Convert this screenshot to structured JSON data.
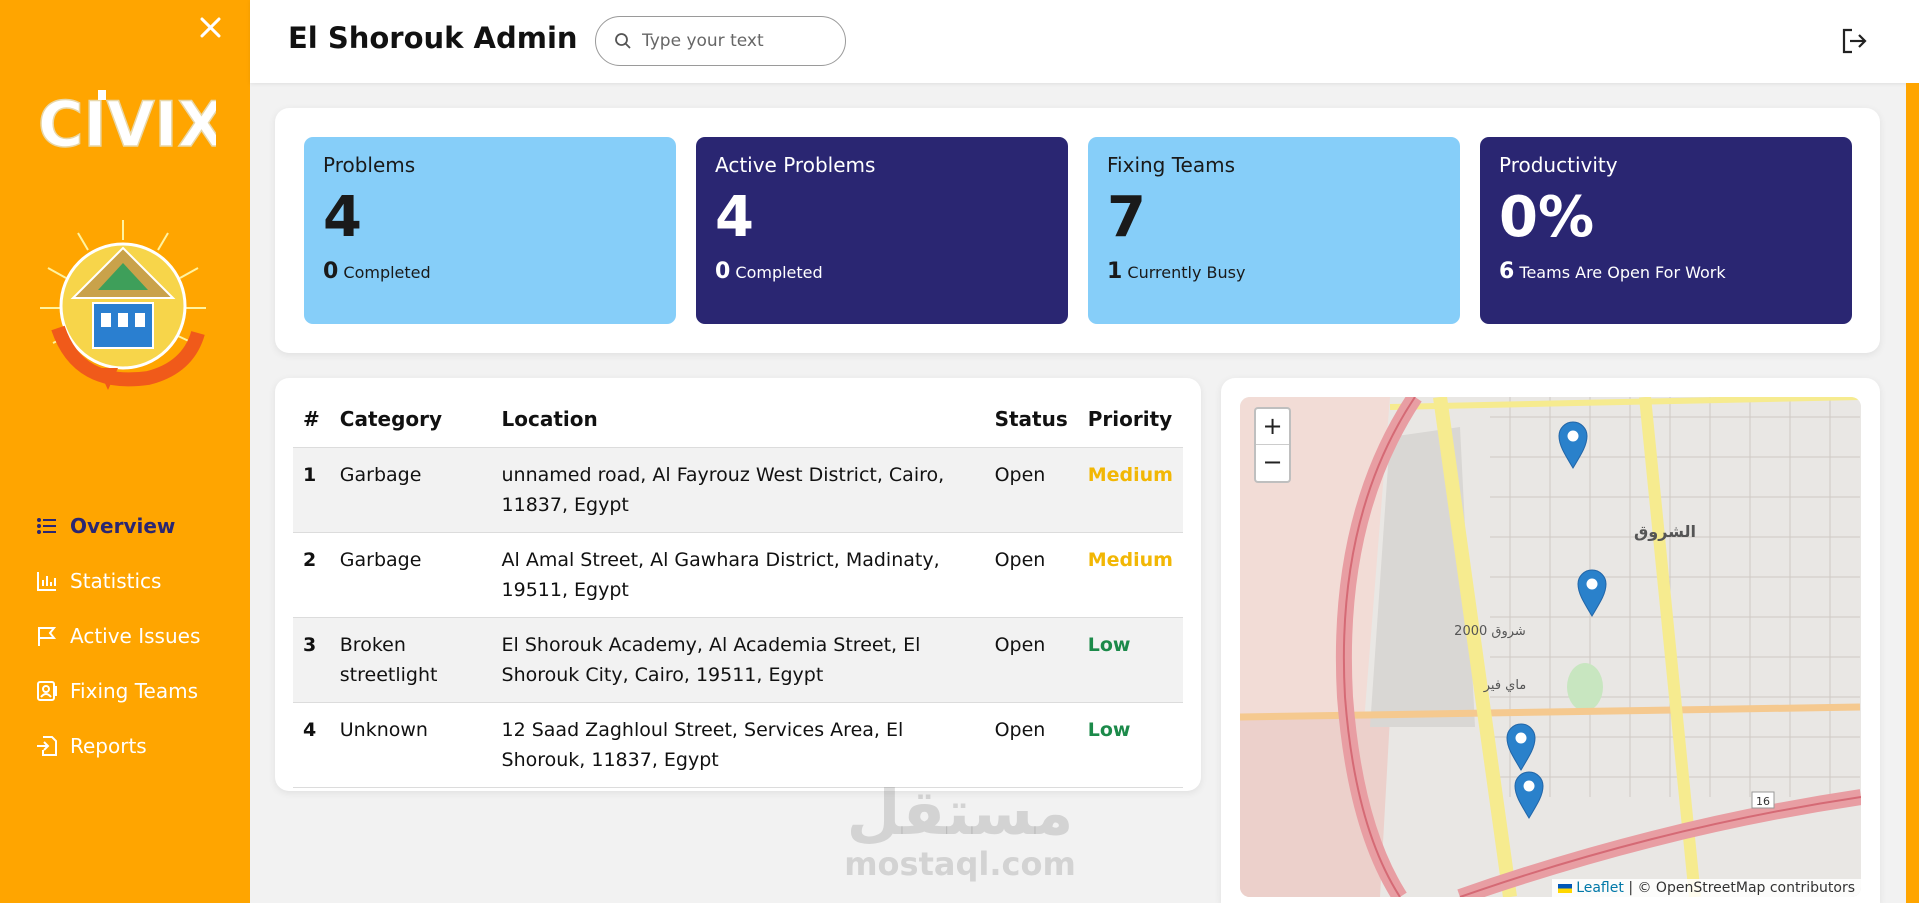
{
  "app": {
    "brand": "CIVIX",
    "brand_color": "#ffa500",
    "accent_dark": "#2a2672",
    "accent_light": "#86cef9"
  },
  "header": {
    "title": "El Shorouk Admin",
    "search_placeholder": "Type your text"
  },
  "sidebar": {
    "items": [
      {
        "label": "Overview",
        "icon": "list-icon",
        "active": true
      },
      {
        "label": "Statistics",
        "icon": "bar-chart-icon",
        "active": false
      },
      {
        "label": "Active Issues",
        "icon": "flag-icon",
        "active": false
      },
      {
        "label": "Fixing Teams",
        "icon": "team-icon",
        "active": false
      },
      {
        "label": "Reports",
        "icon": "report-icon",
        "active": false
      }
    ]
  },
  "stats": [
    {
      "title": "Problems",
      "value": "4",
      "sub_value": "0",
      "sub_label": "Completed",
      "style": "light"
    },
    {
      "title": "Active Problems",
      "value": "4",
      "sub_value": "0",
      "sub_label": "Completed",
      "style": "dark"
    },
    {
      "title": "Fixing Teams",
      "value": "7",
      "sub_value": "1",
      "sub_label": "Currently Busy",
      "style": "light"
    },
    {
      "title": "Productivity",
      "value": "0%",
      "sub_value": "6",
      "sub_label": "Teams Are Open For Work",
      "style": "dark"
    }
  ],
  "table": {
    "headers": [
      "#",
      "Category",
      "Location",
      "Status",
      "Priority"
    ],
    "rows": [
      {
        "num": "1",
        "category": "Garbage",
        "location": "unnamed road, Al Fayrouz West District, Cairo, 11837, Egypt",
        "status": "Open",
        "priority": "Medium"
      },
      {
        "num": "2",
        "category": "Garbage",
        "location": "Al Amal Street, Al Gawhara District, Madinaty, 19511, Egypt",
        "status": "Open",
        "priority": "Medium"
      },
      {
        "num": "3",
        "category": "Broken streetlight",
        "location": "El Shorouk Academy, Al Academia Street, El Shorouk City, Cairo, 19511, Egypt",
        "status": "Open",
        "priority": "Low"
      },
      {
        "num": "4",
        "category": "Unknown",
        "location": "12 Saad Zaghloul Street, Services Area, El Shorouk, 11837, Egypt",
        "status": "Open",
        "priority": "Low"
      }
    ]
  },
  "map": {
    "zoom_in": "+",
    "zoom_out": "−",
    "attribution_link": "Leaflet",
    "attribution_text": "| © OpenStreetMap contributors",
    "labels": {
      "shorouk": "الشروق",
      "shorouk2000": "شروق 2000",
      "mayfair": "ماي فير",
      "road_number": "16"
    },
    "marker_count": 4
  },
  "watermark": {
    "arabic": "مستقل",
    "latin": "mostaql.com"
  }
}
